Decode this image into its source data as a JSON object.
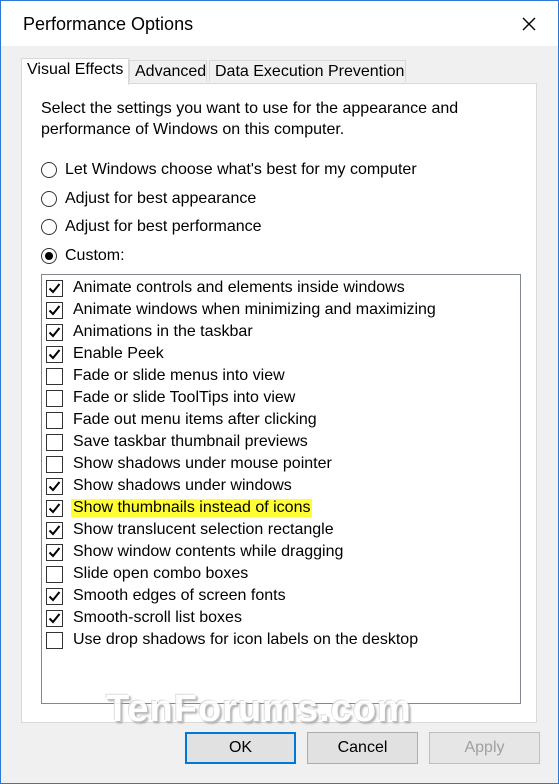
{
  "window": {
    "title": "Performance Options"
  },
  "tabs": [
    {
      "label": "Visual Effects",
      "active": true
    },
    {
      "label": "Advanced",
      "active": false
    },
    {
      "label": "Data Execution Prevention",
      "active": false
    }
  ],
  "visual_effects": {
    "description": "Select the settings you want to use for the appearance and performance of Windows on this computer.",
    "radios": [
      {
        "label": "Let Windows choose what's best for my computer",
        "selected": false
      },
      {
        "label": "Adjust for best appearance",
        "selected": false
      },
      {
        "label": "Adjust for best performance",
        "selected": false
      },
      {
        "label": "Custom:",
        "selected": true
      }
    ],
    "options": [
      {
        "label": "Animate controls and elements inside windows",
        "checked": true,
        "highlighted": false
      },
      {
        "label": "Animate windows when minimizing and maximizing",
        "checked": true,
        "highlighted": false
      },
      {
        "label": "Animations in the taskbar",
        "checked": true,
        "highlighted": false
      },
      {
        "label": "Enable Peek",
        "checked": true,
        "highlighted": false
      },
      {
        "label": "Fade or slide menus into view",
        "checked": false,
        "highlighted": false
      },
      {
        "label": "Fade or slide ToolTips into view",
        "checked": false,
        "highlighted": false
      },
      {
        "label": "Fade out menu items after clicking",
        "checked": false,
        "highlighted": false
      },
      {
        "label": "Save taskbar thumbnail previews",
        "checked": false,
        "highlighted": false
      },
      {
        "label": "Show shadows under mouse pointer",
        "checked": false,
        "highlighted": false
      },
      {
        "label": "Show shadows under windows",
        "checked": true,
        "highlighted": false
      },
      {
        "label": "Show thumbnails instead of icons",
        "checked": true,
        "highlighted": true
      },
      {
        "label": "Show translucent selection rectangle",
        "checked": true,
        "highlighted": false
      },
      {
        "label": "Show window contents while dragging",
        "checked": true,
        "highlighted": false
      },
      {
        "label": "Slide open combo boxes",
        "checked": false,
        "highlighted": false
      },
      {
        "label": "Smooth edges of screen fonts",
        "checked": true,
        "highlighted": false
      },
      {
        "label": "Smooth-scroll list boxes",
        "checked": true,
        "highlighted": false
      },
      {
        "label": "Use drop shadows for icon labels on the desktop",
        "checked": false,
        "highlighted": false
      }
    ]
  },
  "buttons": {
    "ok": "OK",
    "cancel": "Cancel",
    "apply": "Apply"
  },
  "watermark": "TenForums.com",
  "colors": {
    "accent": "#0078d7",
    "highlight": "#ffff33",
    "window_border": "#2b79d7"
  }
}
